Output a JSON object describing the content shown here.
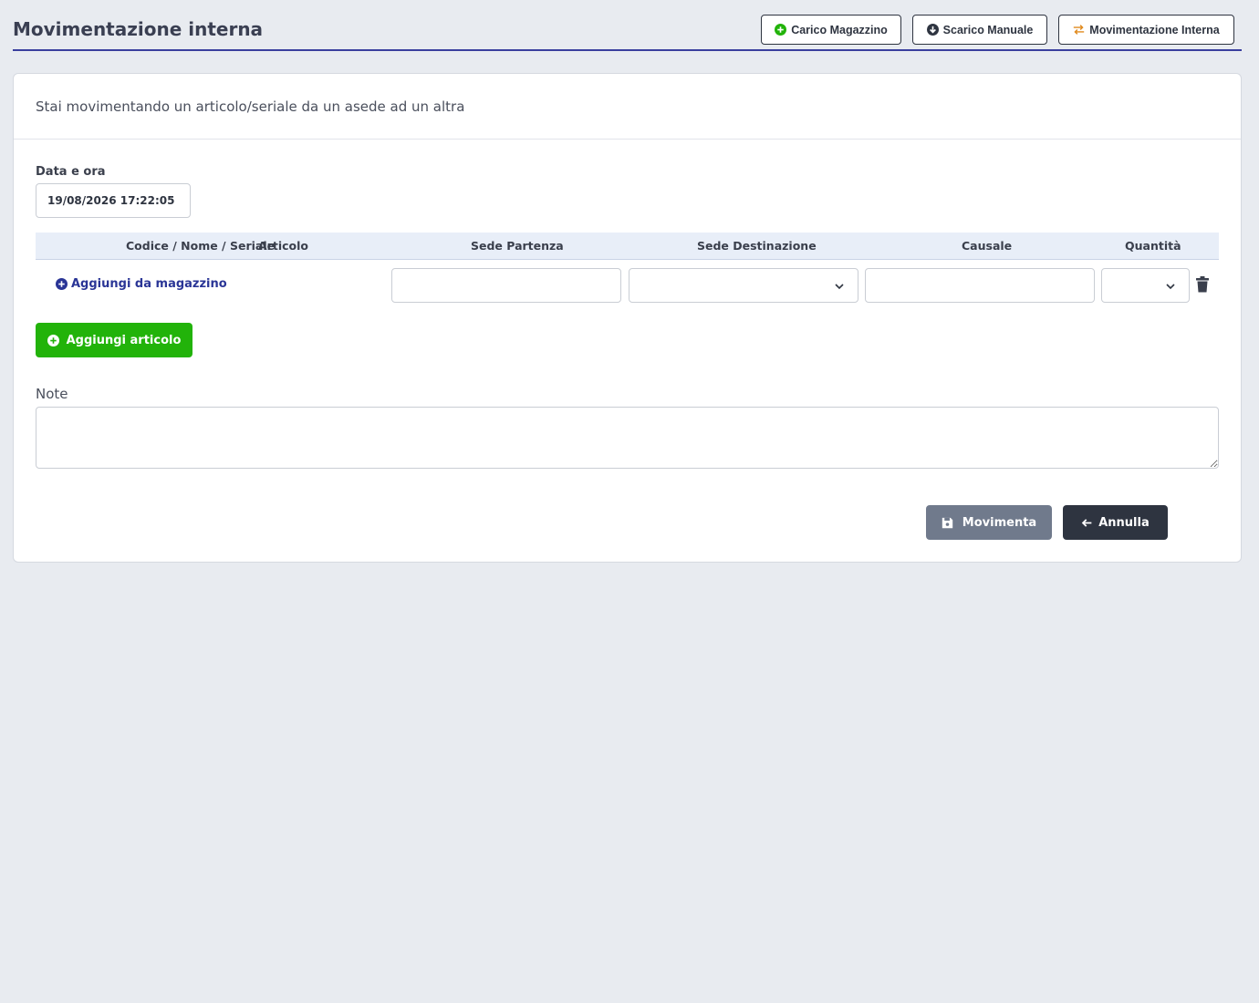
{
  "header": {
    "title": "Movimentazione interna",
    "buttons": [
      {
        "label": "Carico Magazzino",
        "icon": "plus-circle-icon",
        "icon_color": "#22b30a"
      },
      {
        "label": "Scarico Manuale",
        "icon": "arrow-down-circle-icon",
        "icon_color": "#2e3440"
      },
      {
        "label": "Movimentazione Interna",
        "icon": "swap-arrows-icon",
        "icon_color": "#e08a1e"
      }
    ]
  },
  "card": {
    "description": "Stai movimentando un articolo/seriale da un asede ad un altra",
    "date_field": {
      "label": "Data e ora",
      "value": "19/08/2026 17:22:05"
    },
    "table": {
      "columns": [
        "Codice / Nome / Seriale",
        "Articolo",
        "Sede Partenza",
        "Sede Destinazione",
        "Causale",
        "Quantità"
      ],
      "row": {
        "add_link": "Aggiungi da magazzino",
        "sede_partenza": "",
        "sede_destinazione": "",
        "causale": "",
        "quantita": ""
      }
    },
    "add_button": "Aggiungi articolo",
    "note": {
      "label": "Note",
      "value": ""
    },
    "actions": {
      "submit": "Movimenta",
      "cancel": "Annulla"
    }
  },
  "colors": {
    "accent": "#3a3f9e",
    "success": "#22b30a",
    "submit_bg": "#707a8c",
    "cancel_bg": "#2e3440",
    "link": "#2a3596"
  }
}
